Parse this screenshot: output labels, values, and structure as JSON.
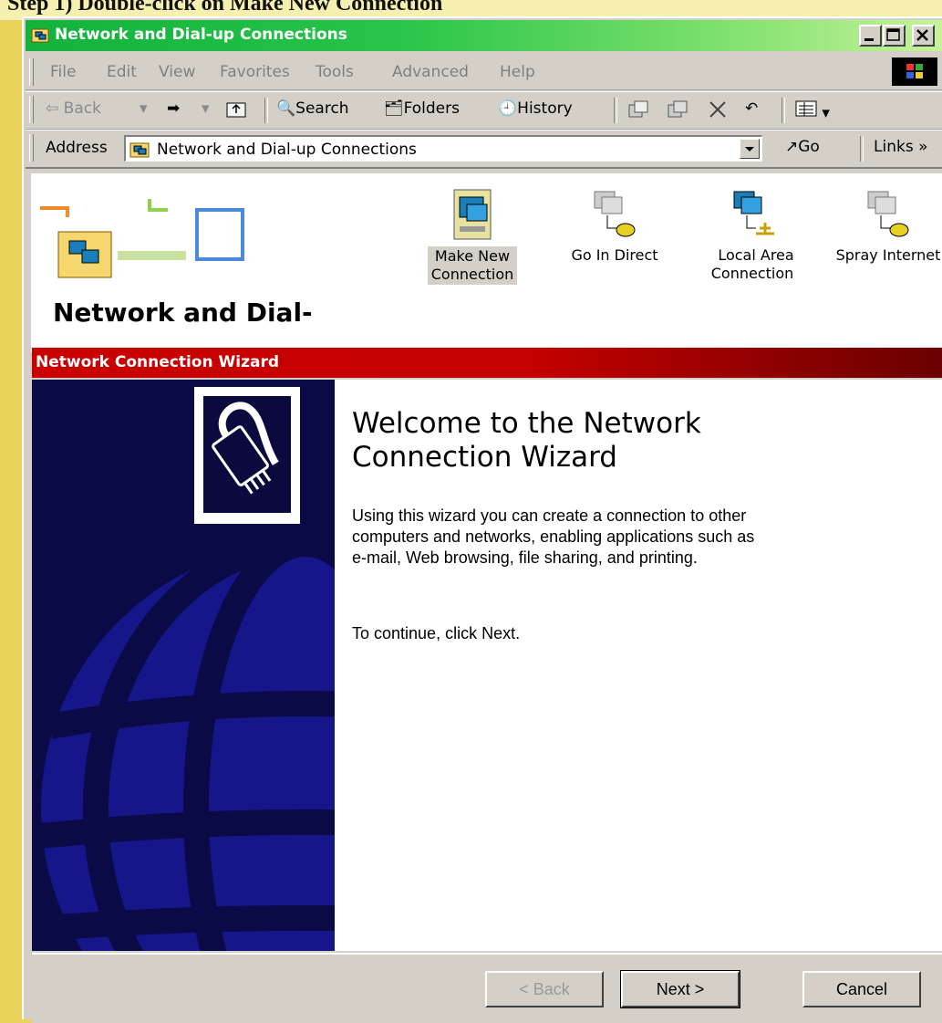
{
  "doc_strip_text": "Step 1) Double-click on Make New Connection",
  "window": {
    "title": "Network and Dial-up Connections"
  },
  "menu": [
    "File",
    "Edit",
    "View",
    "Favorites",
    "Tools",
    "Advanced",
    "Help"
  ],
  "toolbar": {
    "back": "Back",
    "search": "Search",
    "folders": "Folders",
    "history": "History"
  },
  "address": {
    "label": "Address",
    "value": "Network and Dial-up Connections",
    "go": "Go",
    "links": "Links"
  },
  "folder": {
    "title": "Network and Dial-",
    "connections": [
      {
        "line1": "Make New",
        "line2": "Connection",
        "selected": true
      },
      {
        "line1": "Go In Direct",
        "line2": ""
      },
      {
        "line1": "Local Area",
        "line2": "Connection"
      },
      {
        "line1": "Spray Internet",
        "line2": ""
      }
    ]
  },
  "wizard": {
    "title": "Network Connection Wizard",
    "heading_line1": "Welcome to the Network",
    "heading_line2": "Connection Wizard",
    "text_line1": "Using this wizard you can create a connection to other",
    "text_line2": "computers and networks, enabling applications such as",
    "text_line3": "e-mail, Web browsing, file sharing, and printing.",
    "continue": "To continue, click Next.",
    "back_button": "< Back",
    "next_button": "Next >",
    "cancel_button": "Cancel"
  }
}
